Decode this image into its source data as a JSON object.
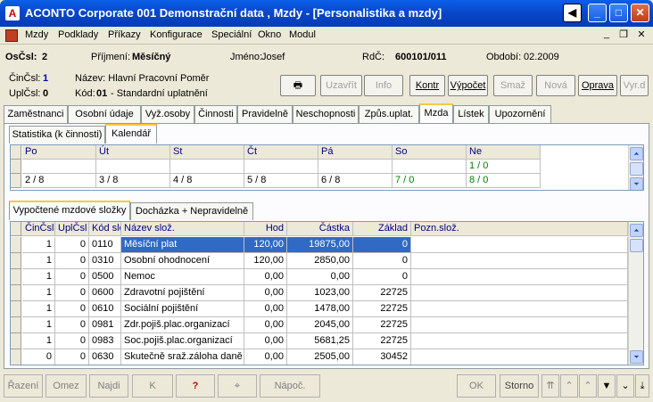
{
  "window": {
    "title": "ACONTO Corporate 001 Demonstrační data , Mzdy - [Personalistika a mzdy]"
  },
  "menu": [
    "Mzdy",
    "Podklady",
    "Příkazy",
    "Konfigurace",
    "Speciální",
    "Okno",
    "Modul"
  ],
  "header": {
    "oscsl_label": "OsČsl:",
    "oscsl_value": "2",
    "prijmeni_label": "Příjmení:",
    "prijmeni_value": "Měsíčný",
    "jmeno_label": "Jméno:",
    "jmeno_value": "Josef",
    "rdc_label": "RdČ:",
    "rdc_value": "600101/011",
    "obdobi_label": "Období:",
    "obdobi_value": "02.2009"
  },
  "info": {
    "cincsl_label": "ČinČsl:",
    "cincsl_value": "1",
    "uplcsl_label": "UplČsl:",
    "uplcsl_value": "0",
    "nazev": "Název: Hlavní Pracovní Poměr",
    "kod_label": "Kód:",
    "kod_value": "01",
    "kod_text": "- Standardní uplatnění"
  },
  "toolbar": {
    "uzavrit": "Uzavřít",
    "info": "Info",
    "kontr": "Kontr",
    "vypocet": "Výpočet",
    "smaz": "Smaž",
    "nova": "Nová",
    "oprava": "Oprava",
    "vyrd": "Vyr.d"
  },
  "main_tabs": [
    "Zaměstnanci",
    "Osobní údaje",
    "Vyž.osoby",
    "Činnosti",
    "Pravidelně",
    "Neschopnosti",
    "Způs.uplat.",
    "Mzda",
    "Lístek",
    "Upozornění"
  ],
  "sub_tabs": [
    "Statistika (k činnosti)",
    "Kalendář"
  ],
  "calendar": {
    "headers": [
      "Po",
      "Út",
      "St",
      "Čt",
      "Pá",
      "So",
      "Ne"
    ],
    "row1": [
      "",
      "",
      "",
      "",
      "",
      "",
      "1 / 0"
    ],
    "row2": [
      "2 / 8",
      "3 / 8",
      "4 / 8",
      "5 / 8",
      "6 / 8",
      "7 / 0",
      "8 / 0"
    ]
  },
  "lower_tabs": [
    "Vypočtené mzdové složky",
    "Docházka + Nepravidelně"
  ],
  "table": {
    "headers": [
      "ČinČsl",
      "UplČsl",
      "Kód slo",
      "Název slož.",
      "Hod",
      "Částka",
      "Základ",
      "Pozn.slož."
    ],
    "rows": [
      [
        "1",
        "0",
        "0110",
        "Měsíční plat",
        "120,00",
        "19875,00",
        "0",
        ""
      ],
      [
        "1",
        "0",
        "0310",
        "Osobní ohodnocení",
        "120,00",
        "2850,00",
        "0",
        ""
      ],
      [
        "1",
        "0",
        "0500",
        "Nemoc",
        "0,00",
        "0,00",
        "0",
        ""
      ],
      [
        "1",
        "0",
        "0600",
        "Zdravotní pojištění",
        "0,00",
        "1023,00",
        "22725",
        ""
      ],
      [
        "1",
        "0",
        "0610",
        "Sociální pojištění",
        "0,00",
        "1478,00",
        "22725",
        ""
      ],
      [
        "1",
        "0",
        "0981",
        "Zdr.pojiš.plac.organizací",
        "0,00",
        "2045,00",
        "22725",
        ""
      ],
      [
        "1",
        "0",
        "0983",
        "Soc.pojiš.plac.organizací",
        "0,00",
        "5681,25",
        "22725",
        ""
      ],
      [
        "0",
        "0",
        "0630",
        "Skutečně sraž.záloha daně",
        "0,00",
        "2505,00",
        "30452",
        ""
      ]
    ]
  },
  "bottom": {
    "razeni": "Řazení",
    "omez": "Omez",
    "najdi": "Najdi",
    "k": "K",
    "help": "?",
    "napoc": "Nápoč.",
    "ok": "OK",
    "storno": "Storno"
  }
}
